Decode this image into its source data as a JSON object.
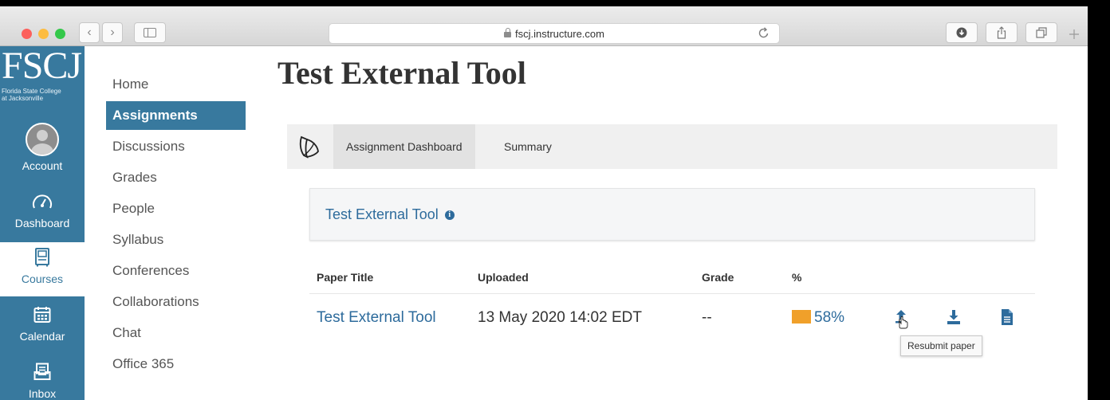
{
  "browser": {
    "url": "fscj.instructure.com",
    "back_icon": "‹",
    "forward_icon": "›"
  },
  "logo": {
    "mark": "FSCJ",
    "subtitle_line1": "Florida State College",
    "subtitle_line2": "at Jacksonville"
  },
  "global_nav": {
    "items": [
      {
        "label": "Account",
        "icon": "avatar"
      },
      {
        "label": "Dashboard",
        "icon": "dashboard-icon"
      },
      {
        "label": "Courses",
        "icon": "courses-icon"
      },
      {
        "label": "Calendar",
        "icon": "calendar-icon"
      },
      {
        "label": "Inbox",
        "icon": "inbox-icon"
      }
    ],
    "active": "Courses"
  },
  "course_nav": {
    "items": [
      "Home",
      "Assignments",
      "Discussions",
      "Grades",
      "People",
      "Syllabus",
      "Conferences",
      "Collaborations",
      "Chat",
      "Office 365"
    ],
    "active": "Assignments"
  },
  "page_title": "Test External Tool",
  "tool_tabs": {
    "items": [
      "Assignment Dashboard",
      "Summary"
    ],
    "active": "Assignment Dashboard"
  },
  "assignment_card": {
    "title": "Test External Tool",
    "info_glyph": "i"
  },
  "table": {
    "headers": [
      "Paper Title",
      "Uploaded",
      "Grade",
      "%"
    ],
    "rows": [
      {
        "title": "Test External Tool",
        "uploaded": "13 May 2020 14:02 EDT",
        "grade": "--",
        "similarity": "58%"
      }
    ]
  },
  "tooltip": "Resubmit paper",
  "colors": {
    "brand": "#38799e",
    "link": "#2d6b9c",
    "similarity_orange": "#f0a02a"
  }
}
